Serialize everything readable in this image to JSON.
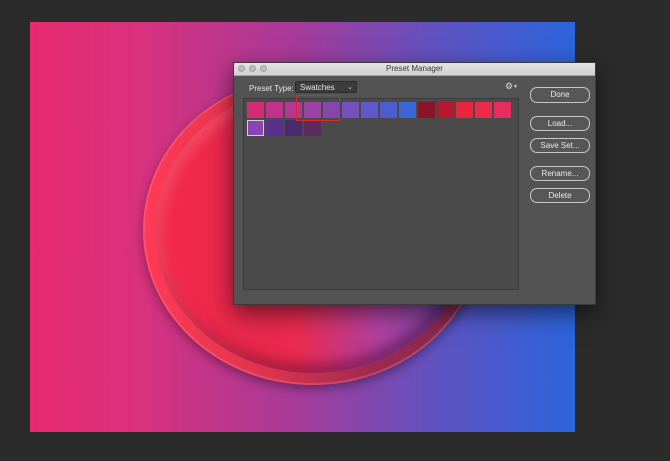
{
  "dialog": {
    "title": "Preset Manager",
    "preset_type_label": "Preset Type:",
    "preset_type_value": "Swatches",
    "buttons": {
      "done": "Done",
      "load": "Load...",
      "save_set": "Save Set...",
      "rename": "Rename...",
      "delete": "Delete"
    }
  },
  "swatches": [
    {
      "color": "#d52a74"
    },
    {
      "color": "#c0328e"
    },
    {
      "color": "#b33895"
    },
    {
      "color": "#9b42a3"
    },
    {
      "color": "#8746ad"
    },
    {
      "color": "#7452bc"
    },
    {
      "color": "#5e58c9"
    },
    {
      "color": "#4a5ed0"
    },
    {
      "color": "#3b66d9"
    },
    {
      "color": "#8a1428"
    },
    {
      "color": "#b8172f"
    },
    {
      "color": "#e8243f"
    },
    {
      "color": "#ee2a49"
    },
    {
      "color": "#e82e60"
    },
    {
      "color": "#8b44b6",
      "selected": true
    },
    {
      "color": "#5b2f8f"
    },
    {
      "color": "#4a2b6d"
    },
    {
      "color": "#5c2a5c"
    }
  ]
}
